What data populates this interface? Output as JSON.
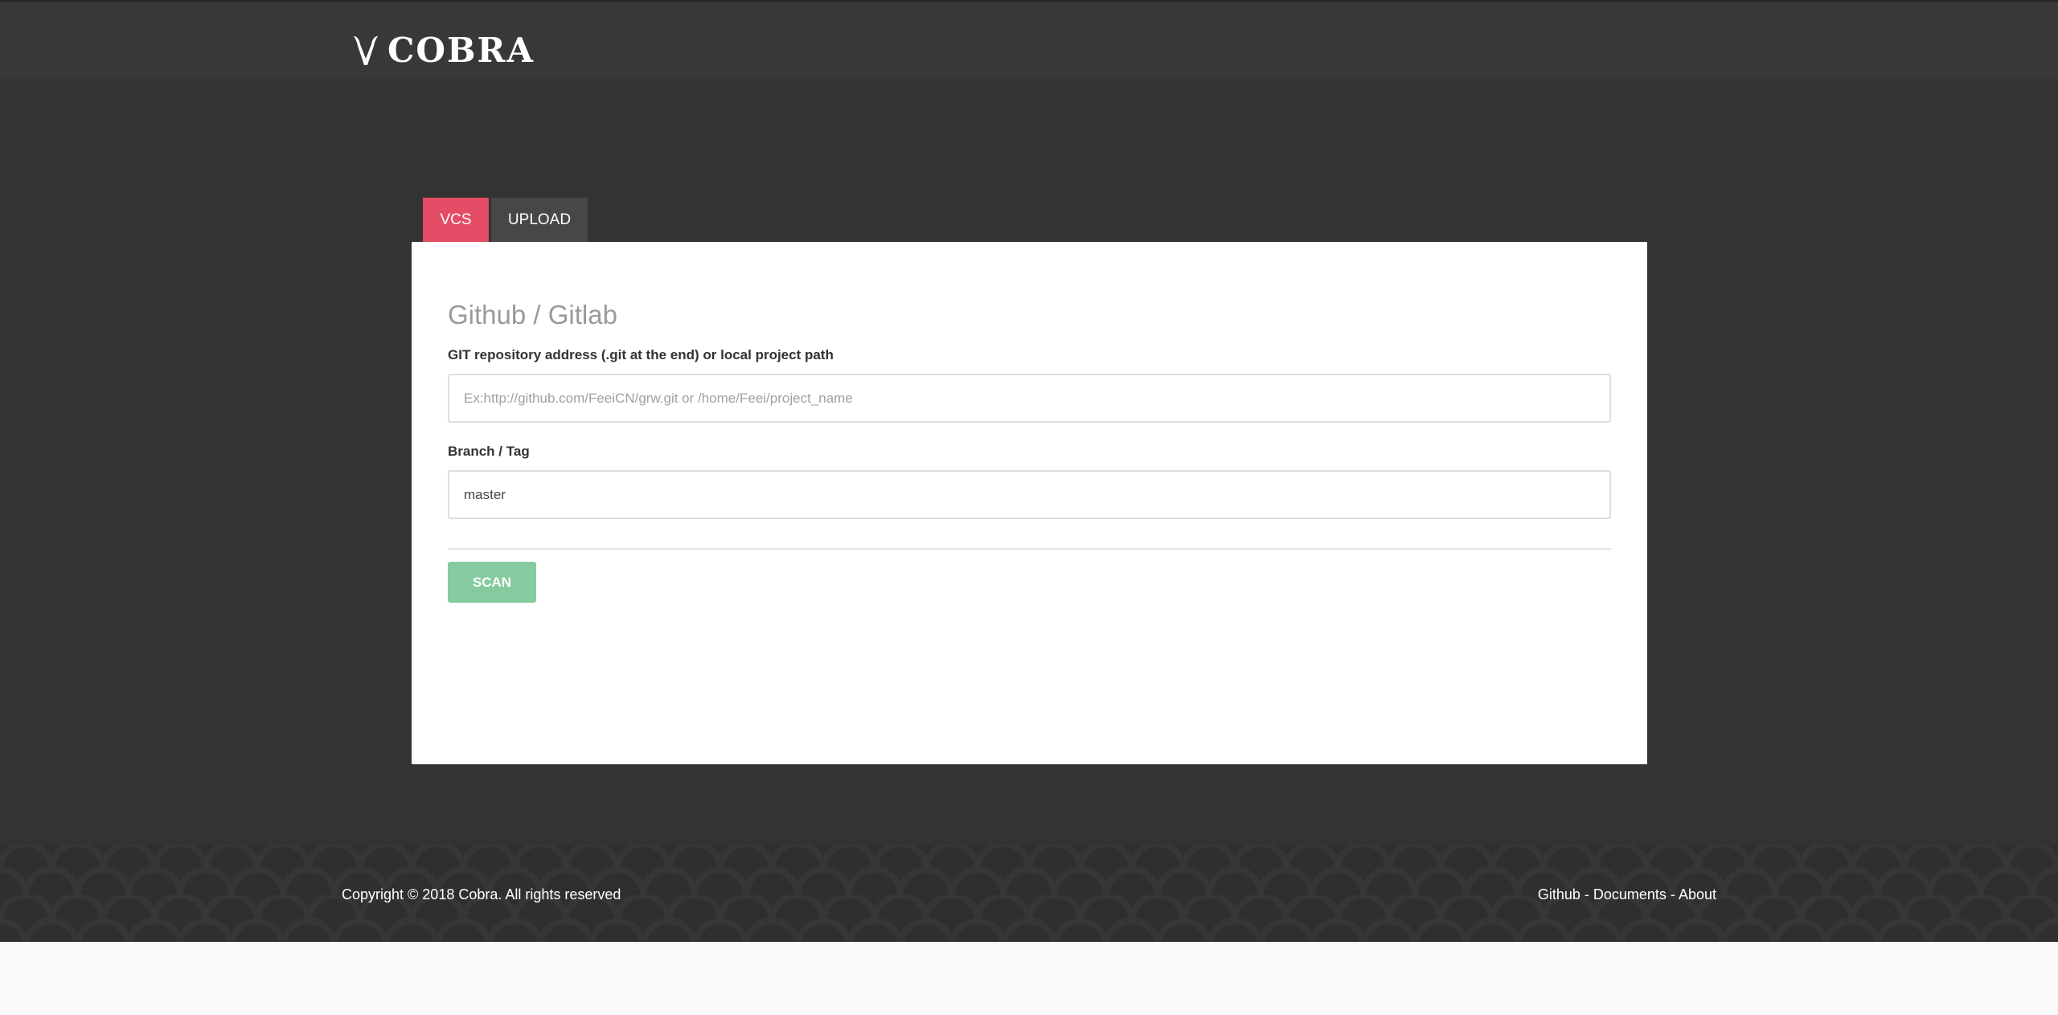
{
  "brand": {
    "name": "COBRA"
  },
  "tabs": [
    {
      "label": "VCS",
      "active": true
    },
    {
      "label": "UPLOAD",
      "active": false
    }
  ],
  "form": {
    "title": "Github / Gitlab",
    "repo_label": "GIT repository address (.git at the end) or local project path",
    "repo_placeholder": "Ex:http://github.com/FeeiCN/grw.git or /home/Feei/project_name",
    "repo_value": "",
    "branch_label": "Branch / Tag",
    "branch_value": "master",
    "scan_label": "SCAN"
  },
  "footer": {
    "copyright": "Copyright © 2018 Cobra. All rights reserved",
    "links": [
      {
        "label": "Github"
      },
      {
        "label": "Documents"
      },
      {
        "label": "About"
      }
    ],
    "separator": " - "
  },
  "colors": {
    "background": "#333333",
    "tab_active": "#e34c64",
    "tab_inactive": "#474747",
    "scan_button": "#86cba0"
  }
}
